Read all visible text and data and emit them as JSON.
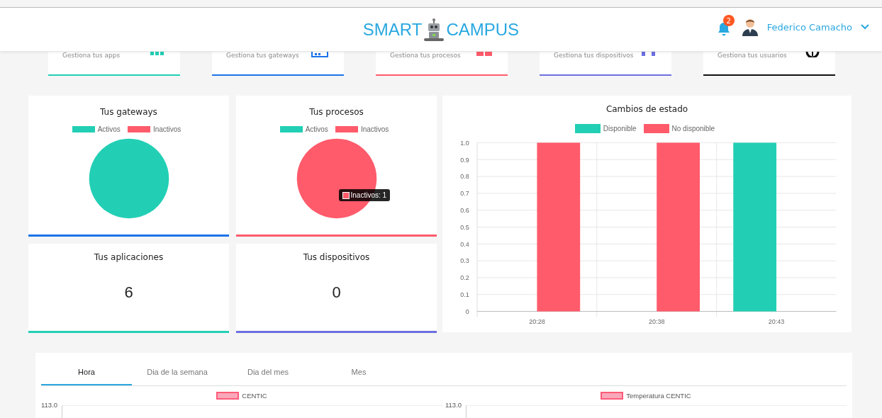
{
  "header": {
    "logo_left": "SMART",
    "logo_right": "CAMPUS",
    "notifications": "2",
    "user": "Federico Camacho"
  },
  "shortcuts": [
    {
      "label": "Gestiona tus apps",
      "kind": "apps",
      "color": "#22cfb5"
    },
    {
      "label": "Gestiona tus gateways",
      "kind": "gateways",
      "color": "#1a73e8"
    },
    {
      "label": "Gestiona tus procesos",
      "kind": "procesos",
      "color": "#ff5b6b"
    },
    {
      "label": "Gestiona tus dispositivos",
      "kind": "dispositivos",
      "color": "#6c6fe0"
    },
    {
      "label": "Gestiona tus usuarios",
      "kind": "usuarios",
      "color": "#111111"
    }
  ],
  "pie_cards": [
    {
      "title": "Tus gateways",
      "color": "#1a73e8",
      "chart_data": {
        "type": "pie",
        "categories": [
          "Activos",
          "Inactivos"
        ],
        "values": [
          1,
          0
        ],
        "colors": [
          "#22cfb5",
          "#ff5b6b"
        ]
      }
    },
    {
      "title": "Tus procesos",
      "color": "#ff5b6b",
      "tooltip": "Inactivos: 1",
      "chart_data": {
        "type": "pie",
        "categories": [
          "Activos",
          "Inactivos"
        ],
        "values": [
          0,
          1
        ],
        "colors": [
          "#22cfb5",
          "#ff5b6b"
        ]
      }
    }
  ],
  "count_cards": [
    {
      "title": "Tus aplicaciones",
      "value": "6",
      "color": "#22cfb5"
    },
    {
      "title": "Tus dispositivos",
      "value": "0",
      "color": "#6c6fe0"
    }
  ],
  "status_chart": {
    "title": "Cambios de estado",
    "chart_data": {
      "type": "bar",
      "categories": [
        "20:28",
        "20:38",
        "20:43"
      ],
      "series": [
        {
          "name": "Disponible",
          "color": "#22cfb5",
          "values": [
            0,
            0,
            1
          ]
        },
        {
          "name": "No disponible",
          "color": "#ff5b6b",
          "values": [
            1,
            1,
            0
          ]
        }
      ],
      "grid": true,
      "ylim": [
        0,
        1
      ],
      "yticks": [
        0,
        0.1,
        0.2,
        0.3,
        0.4,
        0.5,
        0.6,
        0.7,
        0.8,
        0.9,
        {
          "value": 1,
          "label": "1.0"
        }
      ]
    }
  },
  "history": {
    "tabs": [
      {
        "label": "Hora",
        "selected": true
      },
      {
        "label": "Dia de la semana",
        "selected": false
      },
      {
        "label": "Dia del mes",
        "selected": false
      },
      {
        "label": "Mes",
        "selected": false
      }
    ],
    "charts": [
      {
        "legend": "CENTIC",
        "ytick": "113.0"
      },
      {
        "legend": "Temperatura CENTIC",
        "ytick": "113.0"
      }
    ]
  }
}
